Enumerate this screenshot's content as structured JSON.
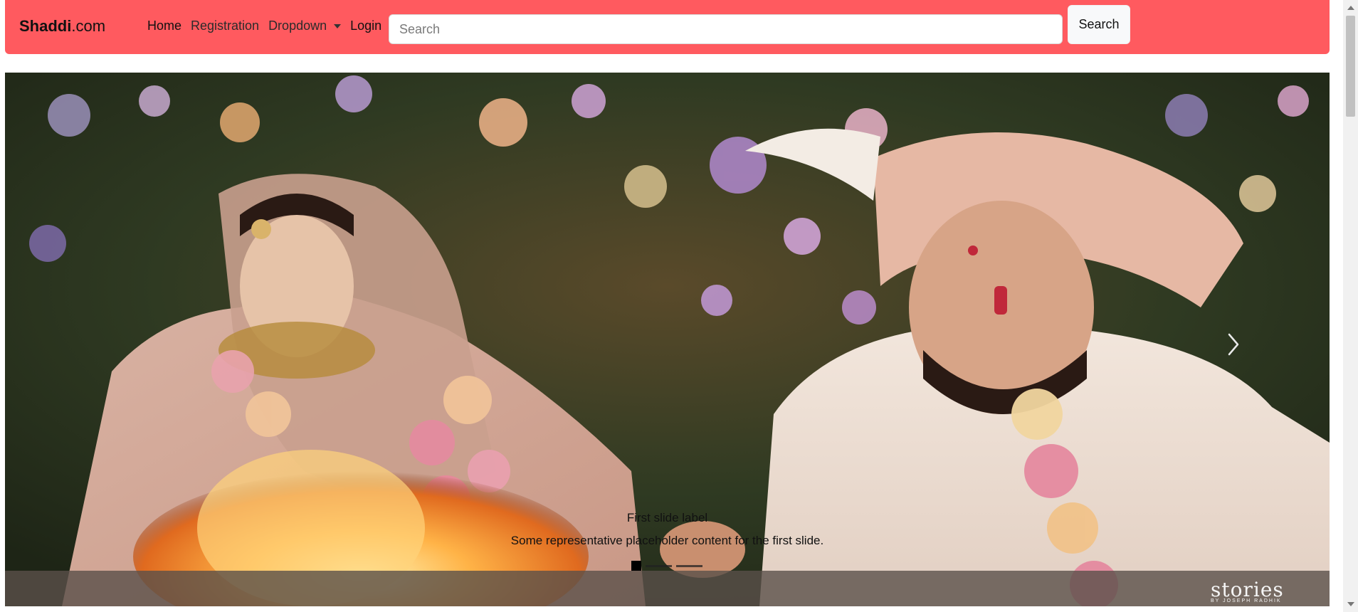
{
  "navbar": {
    "brand_bold": "Shaddi",
    "brand_rest": ".com",
    "links": {
      "home": "Home",
      "registration": "Registration",
      "dropdown": "Dropdown",
      "login": "Login"
    },
    "search_placeholder": "Search",
    "search_button": "Search",
    "background_color": "#ff5a5f"
  },
  "carousel": {
    "caption_title": "First slide label",
    "caption_text": "Some representative placeholder content for the first slide.",
    "watermark": "stories",
    "watermark_sub": "BY JOSEPH RADHIK",
    "indicators": [
      true,
      false,
      false
    ]
  }
}
